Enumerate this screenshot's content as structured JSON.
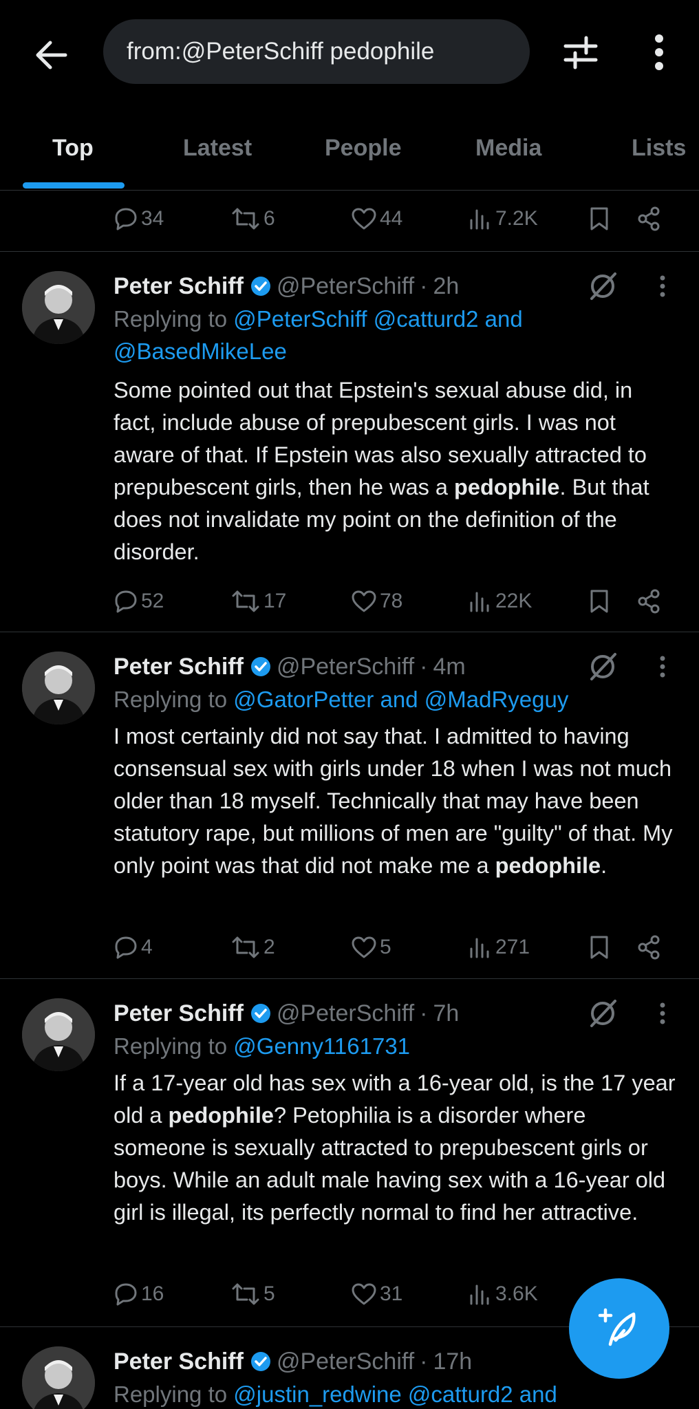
{
  "search": {
    "query": "from:@PeterSchiff pedophile"
  },
  "tabs": [
    {
      "label": "Top"
    },
    {
      "label": "Latest"
    },
    {
      "label": "People"
    },
    {
      "label": "Media"
    },
    {
      "label": "Lists"
    }
  ],
  "colors": {
    "accent": "#1d9bf0",
    "background": "#000000",
    "muted": "#71767b",
    "text": "#e7e9ea"
  },
  "icons": [
    "back-arrow-icon",
    "filter-sliders-icon",
    "more-vertical-icon",
    "reply-icon",
    "retweet-icon",
    "like-icon",
    "views-icon",
    "bookmark-icon",
    "share-icon",
    "verified-icon",
    "grok-icon",
    "compose-icon"
  ],
  "top_actions": {
    "replies": "34",
    "retweets": "6",
    "likes": "44",
    "views": "7.2K"
  },
  "tweets": [
    {
      "name": "Peter Schiff",
      "handle": "@PeterSchiff",
      "sep": "·",
      "time": "2h",
      "reply_prefix": "Replying to",
      "reply_links": [
        "@PeterSchiff @catturd2 and",
        "@BasedMikeLee"
      ],
      "text_parts": [
        "Some pointed out that Epstein's sexual abuse did, in fact, include abuse of prepubescent girls. I was not aware of that. If Epstein was also sexually attracted to prepubescent girls, then he was a ",
        "pedophile",
        ". But that does not invalidate my point on the definition of the disorder."
      ],
      "replies": "52",
      "retweets": "17",
      "likes": "78",
      "views": "22K"
    },
    {
      "name": "Peter Schiff",
      "handle": "@PeterSchiff",
      "sep": "·",
      "time": "4m",
      "reply_prefix": "Replying to",
      "reply_links": [
        "@GatorPetter and @MadRyeguy"
      ],
      "text_parts": [
        "I most certainly did not say that. I admitted to having consensual sex with girls under 18 when I was not much older than 18 myself. Technically that may have been statutory rape, but millions of men are \"guilty\" of that. My only point was that did not make me a ",
        "pedophile",
        "."
      ],
      "replies": "4",
      "retweets": "2",
      "likes": "5",
      "views": "271"
    },
    {
      "name": "Peter Schiff",
      "handle": "@PeterSchiff",
      "sep": "·",
      "time": "7h",
      "reply_prefix": "Replying to",
      "reply_links": [
        "@Genny1161731"
      ],
      "text_parts": [
        "If a 17-year old has sex with a 16-year old, is the 17 year old a ",
        "pedophile",
        "? Petophilia is a disorder where someone is sexually attracted to prepubescent girls or boys. While an adult male having sex with a 16-year old girl is illegal, its perfectly normal to find her attractive."
      ],
      "replies": "16",
      "retweets": "5",
      "likes": "31",
      "views": "3.6K"
    },
    {
      "name": "Peter Schiff",
      "handle": "@PeterSchiff",
      "sep": "·",
      "time": "17h",
      "reply_prefix": "Replying to",
      "reply_links": [
        "@justin_redwine @catturd2 and"
      ]
    }
  ]
}
